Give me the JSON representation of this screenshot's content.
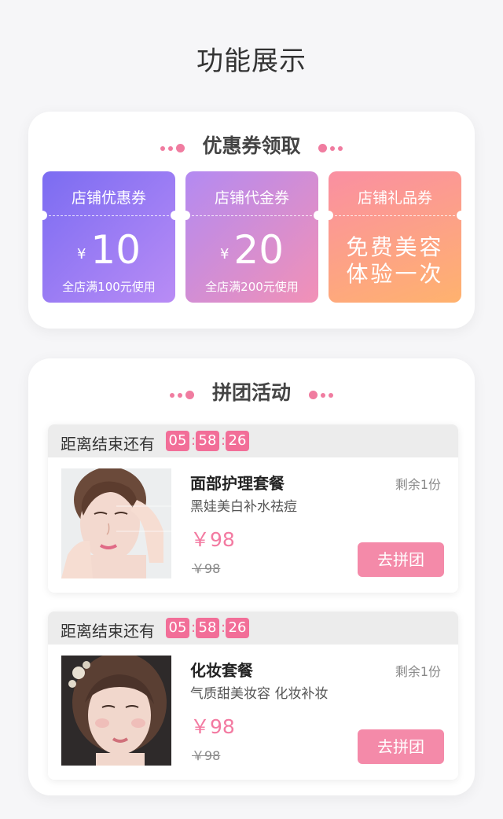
{
  "page": {
    "title": "功能展示"
  },
  "coupons_section": {
    "title": "优惠券领取",
    "items": [
      {
        "name": "店铺优惠券",
        "currency": "¥",
        "amount": "10",
        "condition": "全店满100元使用"
      },
      {
        "name": "店铺代金券",
        "currency": "¥",
        "amount": "20",
        "condition": "全店满200元使用"
      },
      {
        "name": "店铺礼品券",
        "gift_line1": "免费美容",
        "gift_line2": "体验一次"
      }
    ]
  },
  "group_section": {
    "title": "拼团活动",
    "deals": [
      {
        "countdown_label": "距离结束还有",
        "hours": "05",
        "minutes": "58",
        "seconds": "26",
        "name": "面部护理套餐",
        "desc": "黑娃美白补水祛痘",
        "remain": "剩余1份",
        "price": "￥98",
        "old_price": "￥98",
        "button": "去拼团"
      },
      {
        "countdown_label": "距离结束还有",
        "hours": "05",
        "minutes": "58",
        "seconds": "26",
        "name": "化妆套餐",
        "desc": "气质甜美妆容 化妆补妆",
        "remain": "剩余1份",
        "price": "￥98",
        "old_price": "￥98",
        "button": "去拼团"
      }
    ]
  },
  "colors": {
    "accent": "#f26e98",
    "button": "#f48aa9",
    "price": "#f37aa1"
  }
}
